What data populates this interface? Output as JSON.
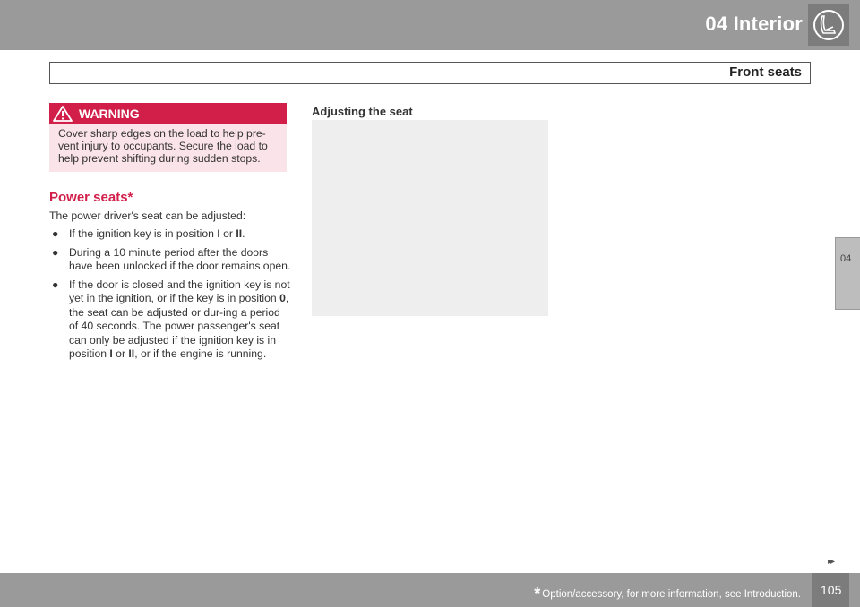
{
  "header": {
    "chapter_title": "04 Interior",
    "chapter_icon": "seat-icon",
    "section_title": "Front seats"
  },
  "warning": {
    "label": "WARNING",
    "text": "Cover sharp edges on the load to help pre-vent injury to occupants. Secure the load to help prevent shifting during sudden stops."
  },
  "power_seats": {
    "heading": "Power seats*",
    "intro": "The power driver's seat can be adjusted:",
    "bullet_marker": "●",
    "bullet1": {
      "text_a": "If the ignition key is in position ",
      "bold_a": "I",
      "text_b": " or ",
      "bold_b": "II",
      "text_c": "."
    },
    "bullet2": {
      "text": "During a 10 minute period after the doors have been unlocked if the door remains open."
    },
    "bullet3": {
      "text_a": "If the door is closed and the ignition key is not yet in the ignition, or if the key is in position ",
      "bold_a": "0",
      "text_b": ", the seat can be adjusted or dur-ing a period of 40 seconds. The power passenger's seat can only be adjusted if the ignition key is in position ",
      "bold_b": "I",
      "text_c": " or ",
      "bold_c": "II",
      "text_d": ", or if the engine is running."
    }
  },
  "adjusting": {
    "heading": "Adjusting the seat"
  },
  "side_tab": {
    "label": "04"
  },
  "nav": {
    "next_arrows": "▸▸"
  },
  "footer": {
    "star": "*",
    "footnote": "Option/accessory, for more information, see Introduction.",
    "page_number": "105"
  },
  "colors": {
    "accent_red": "#d21f4a",
    "warning_bg": "#fbe3ea",
    "band_gray": "#9a9a9a",
    "tab_gray": "#bdbdbd"
  }
}
